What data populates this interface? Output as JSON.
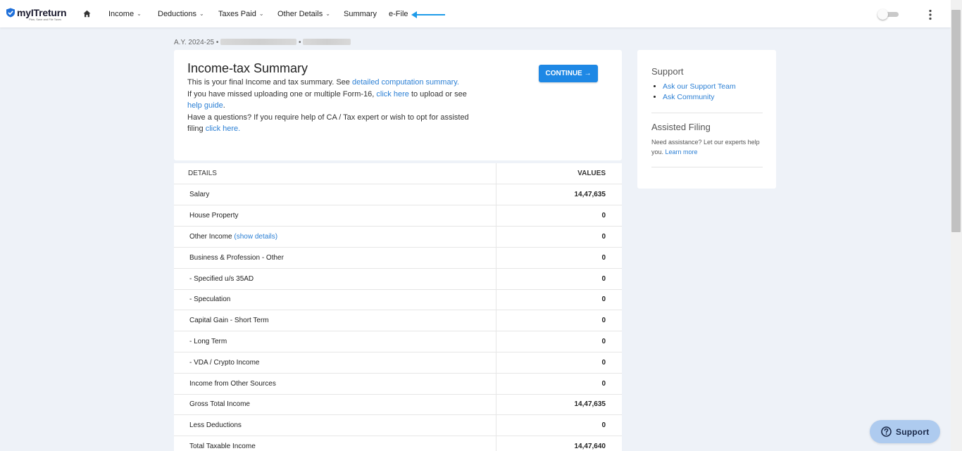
{
  "brand": {
    "name": "myITreturn",
    "tagline": "Plan, Save and File Taxes"
  },
  "nav": {
    "income": "Income",
    "deductions": "Deductions",
    "taxes_paid": "Taxes Paid",
    "other_details": "Other Details",
    "summary": "Summary",
    "efile": "e-File"
  },
  "assessment": {
    "ay": "A.Y. 2024-25 •",
    "sep": "•"
  },
  "summary": {
    "title": "Income-tax Summary",
    "p1_text": "This is your final Income and tax summary. See ",
    "p1_link": "detailed computation summary.",
    "p2_text": "If you have missed uploading one or multiple Form-16, ",
    "p2_link1": "click here",
    "p2_mid": " to upload or see ",
    "p2_link2": "help guide",
    "p2_end": ".",
    "p3_text": "Have a questions? If you require help of CA / Tax expert or wish to opt for assisted filing ",
    "p3_link": "click here.",
    "continue": "CONTINUE"
  },
  "table": {
    "col_details": "DETAILS",
    "col_values": "VALUES",
    "show_details": "(show details)",
    "rows": [
      {
        "label": "Salary",
        "value": "14,47,635"
      },
      {
        "label": "House Property",
        "value": "0"
      },
      {
        "label": "Other Income",
        "value": "0"
      },
      {
        "label": "Business & Profession - Other",
        "value": "0"
      },
      {
        "label": "- Specified u/s 35AD",
        "value": "0"
      },
      {
        "label": "- Speculation",
        "value": "0"
      },
      {
        "label": "Capital Gain - Short Term",
        "value": "0"
      },
      {
        "label": "- Long Term",
        "value": "0"
      },
      {
        "label": "- VDA / Crypto Income",
        "value": "0"
      },
      {
        "label": "Income from Other Sources",
        "value": "0"
      },
      {
        "label": "Gross Total Income",
        "value": "14,47,635"
      },
      {
        "label": "Less Deductions",
        "value": "0"
      },
      {
        "label": "Total Taxable Income",
        "value": "14,47,640"
      }
    ]
  },
  "side": {
    "support_title": "Support",
    "ask_team": "Ask our Support Team",
    "ask_community": "Ask Community",
    "assisted_title": "Assisted Filing",
    "assisted_text": "Need assistance? Let our experts help you. ",
    "learn_more": "Learn more"
  },
  "fab": {
    "label": "Support"
  },
  "colors": {
    "accent": "#1e88e5",
    "link": "#2b7fd4",
    "arrow": "#1e9be9",
    "fab": "#aecbef"
  },
  "icons": {
    "home": "home-icon",
    "chevron": "chevron-down-icon",
    "kebab": "more-vert-icon",
    "help": "help-circle-icon",
    "arrow": "arrow-left-icon"
  }
}
